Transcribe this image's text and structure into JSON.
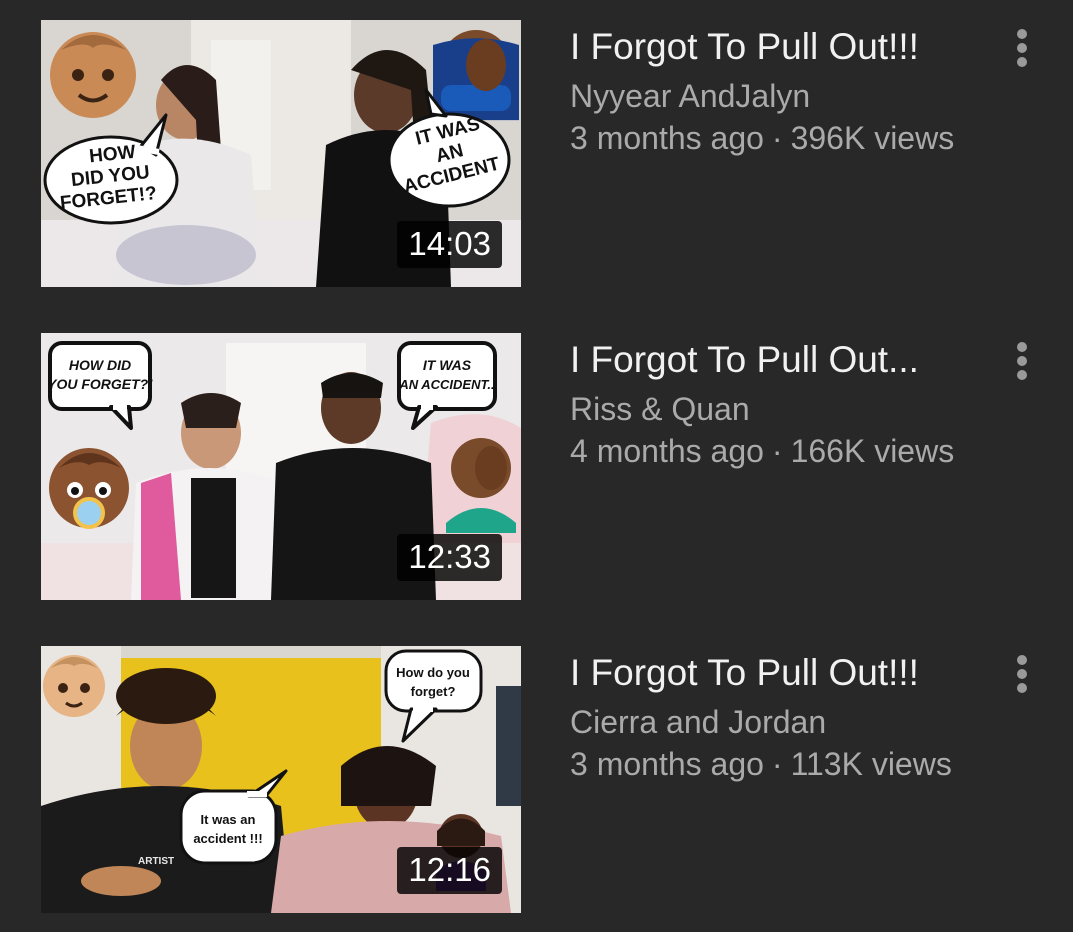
{
  "videos": [
    {
      "title": "I Forgot To Pull Out!!!",
      "channel": "Nyyear AndJalyn",
      "age": "3 months ago",
      "views": "396K views",
      "duration": "14:03",
      "thumb": {
        "left_bubble": [
          "HOW",
          "DID YOU",
          "FORGET!?"
        ],
        "right_bubble": [
          "IT WAS",
          "AN",
          "ACCIDENT"
        ]
      }
    },
    {
      "title": "I Forgot To Pull Out...",
      "channel": "Riss & Quan",
      "age": "4 months ago",
      "views": "166K views",
      "duration": "12:33",
      "thumb": {
        "left_bubble": [
          "HOW DID",
          "YOU FORGET?!"
        ],
        "right_bubble": [
          "IT WAS",
          "AN ACCIDENT.."
        ]
      }
    },
    {
      "title": "I Forgot To Pull Out!!!",
      "channel": "Cierra and Jordan",
      "age": "3 months ago",
      "views": "113K views",
      "duration": "12:16",
      "thumb": {
        "right_bubble": [
          "How do you",
          "forget?"
        ],
        "left_bubble": [
          "It was an",
          "accident !!!"
        ],
        "shirt_text": "ARTIST"
      }
    }
  ],
  "separator": "·",
  "colors": {
    "background": "#282828",
    "title": "#f1f1f1",
    "secondary": "#aaaaaa"
  },
  "icons": {
    "more": "vertical-ellipsis-icon",
    "baby": "baby-face-emoji",
    "facepalm": "facepalm-emoji"
  }
}
